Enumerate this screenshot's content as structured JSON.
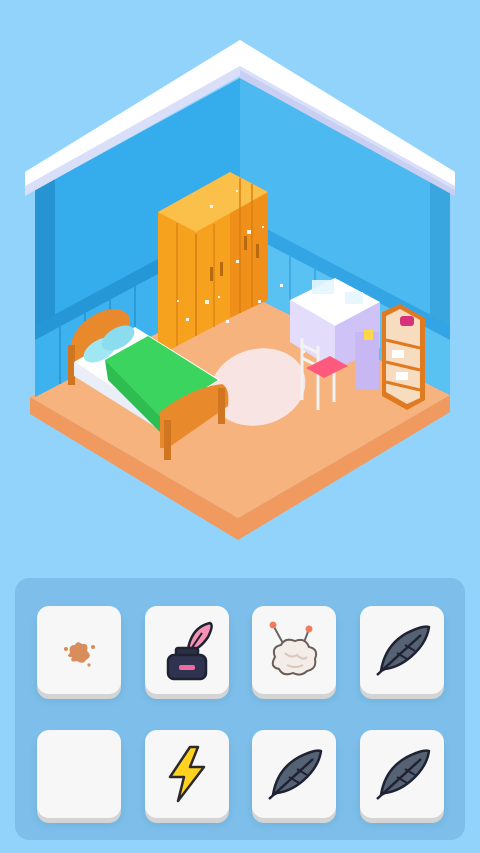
{
  "scene": {
    "name": "isometric-bedroom",
    "colors": {
      "background": "#92d3fb",
      "wall": "#2fa6e6",
      "floor": "#f6b37d",
      "roof": "#ffffff",
      "wardrobe": "#f7a21f",
      "blanket": "#3bd45f"
    }
  },
  "tray": {
    "tiles": [
      {
        "icon": "stain-icon",
        "state": "filled"
      },
      {
        "icon": "ink-bottle-quill-icon",
        "state": "filled"
      },
      {
        "icon": "cotton-pin-icon",
        "state": "filled"
      },
      {
        "icon": "feather-icon",
        "state": "filled"
      },
      {
        "icon": "empty-slot",
        "state": "empty"
      },
      {
        "icon": "lightning-icon",
        "state": "filled"
      },
      {
        "icon": "feather-icon",
        "state": "filled"
      },
      {
        "icon": "feather-icon",
        "state": "filled"
      }
    ]
  }
}
